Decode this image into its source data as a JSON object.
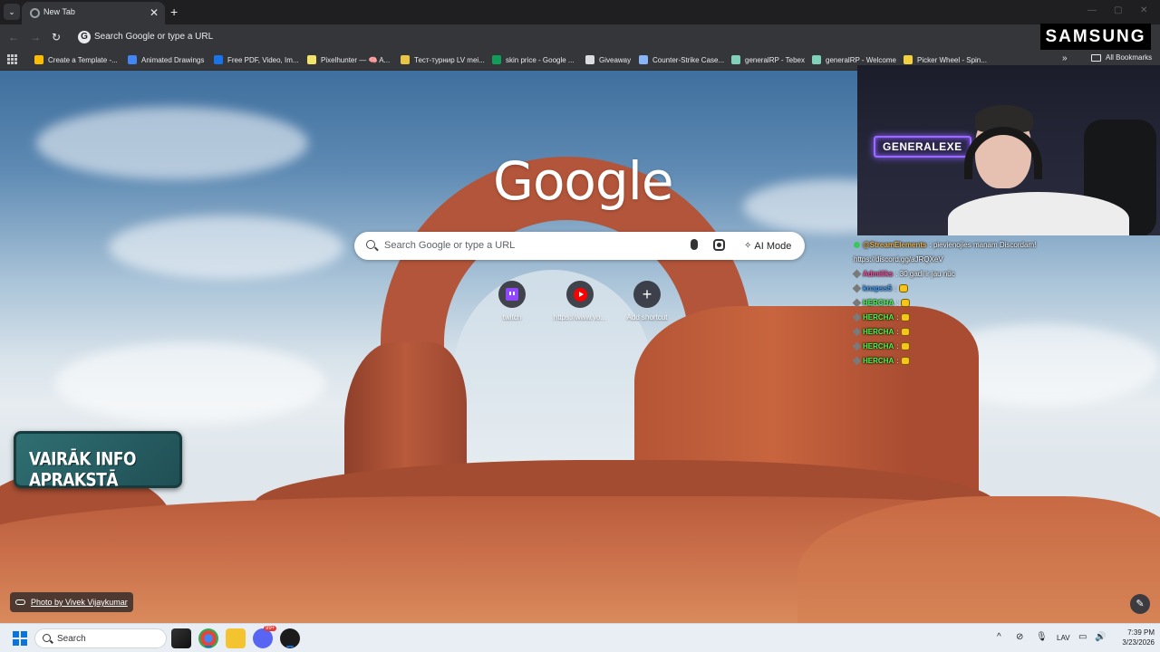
{
  "browser": {
    "tab_title": "New Tab",
    "omnibox_text": "Search Google or type a URL"
  },
  "bookmarks": [
    {
      "label": "Create a Template -...",
      "icon": "template-icon",
      "color": "#fbbc04"
    },
    {
      "label": "Animated Drawings",
      "icon": "meta-icon",
      "color": "#4285f4"
    },
    {
      "label": "Free PDF, Video, Im...",
      "icon": "globe-icon",
      "color": "#1a73e8"
    },
    {
      "label": "Pixelhunter — 🧠 A...",
      "icon": "pixelhunter-icon",
      "color": "#f2e36b"
    },
    {
      "label": "Тест-турнир LV mei...",
      "icon": "star-icon",
      "color": "#e8c547"
    },
    {
      "label": "skin price - Google ...",
      "icon": "sheets-icon",
      "color": "#0f9d58"
    },
    {
      "label": "Giveaway",
      "icon": "giveaway-icon",
      "color": "#dadce0"
    },
    {
      "label": "Counter-Strike Case...",
      "icon": "cs-icon",
      "color": "#8ab4f8"
    },
    {
      "label": "generalRP - Tebex",
      "icon": "tebex-icon",
      "color": "#7fd1b9"
    },
    {
      "label": "generalRP - Welcome",
      "icon": "arrow-icon",
      "color": "#7fd1b9"
    },
    {
      "label": "Picker Wheel - Spin...",
      "icon": "wheel-icon",
      "color": "#f4d03f"
    }
  ],
  "all_bookmarks_label": "All Bookmarks",
  "samsung_label": "SAMSUNG",
  "ntp": {
    "logo_text": "Google",
    "search_placeholder": "Search Google or type a URL",
    "ai_mode_label": "AI Mode",
    "shortcuts": [
      {
        "label": "twitch",
        "icon": "twitch-icon"
      },
      {
        "label": "https://www.yo...",
        "icon": "youtube-icon"
      },
      {
        "label": "Add shortcut",
        "icon": "plus-icon"
      }
    ],
    "photo_credit": "Photo by Vivek Vijaykumar"
  },
  "overlay": {
    "banner_text": "VAIRĀK INFO APRAKSTĀ",
    "webcam_sign": "GENERALEXE"
  },
  "chat": [
    {
      "name": "@StreamElements",
      "name_color": "#f0b34a",
      "message": ": pievienojies manam Discordam!",
      "badge": "green"
    },
    {
      "name": "",
      "name_color": "#ffffff",
      "message": "https://discord.gg/aJRQXeV",
      "badge": "none"
    },
    {
      "name": "Admiiiks",
      "name_color": "#ff4a9e",
      "message": ": 30 gadi ir jau nūc",
      "badge": "sword"
    },
    {
      "name": "knapss5",
      "name_color": "#3fa0ff",
      "message": ":",
      "badge": "sword",
      "emote": true
    },
    {
      "name": "HERCHA",
      "name_color": "#44ff44",
      "message": ":",
      "badge": "sword",
      "emote": true
    },
    {
      "name": "HERCHA",
      "name_color": "#44ff44",
      "message": ":",
      "badge": "sword",
      "emote": true
    },
    {
      "name": "HERCHA",
      "name_color": "#44ff44",
      "message": ":",
      "badge": "sword",
      "emote": true
    },
    {
      "name": "HERCHA",
      "name_color": "#44ff44",
      "message": ":",
      "badge": "sword",
      "emote": true
    },
    {
      "name": "HERCHA",
      "name_color": "#44ff44",
      "message": ":",
      "badge": "sword",
      "emote": true
    }
  ],
  "taskbar": {
    "search_label": "Search",
    "language": "LAV",
    "time": "7:39 PM",
    "date": "3/23/2026",
    "discord_badge": "99+"
  }
}
